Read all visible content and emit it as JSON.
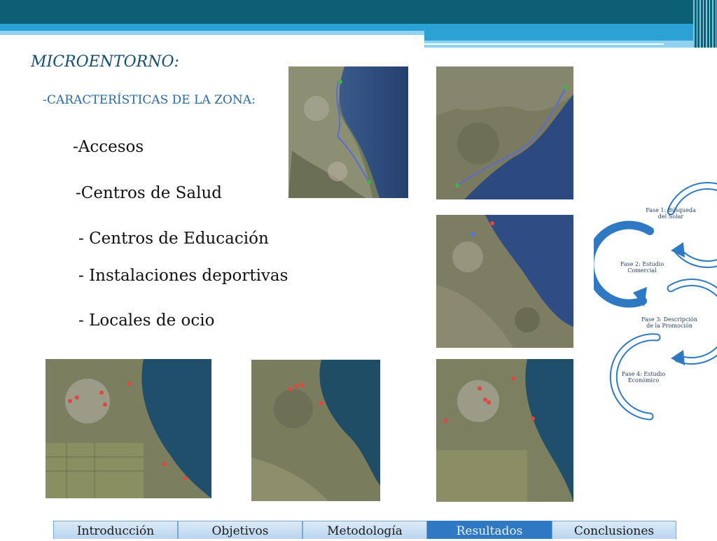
{
  "slide": {
    "title": "MICROENTORNO:",
    "subtitle": "-CARACTERÍSTICAS DE LA ZONA:",
    "items": [
      "-Accesos",
      "-Centros de Salud",
      "- Centros de Educación",
      "- Instalaciones deportivas",
      "- Locales de ocio"
    ]
  },
  "phases": [
    "Fase 1: Búsqueda del Solar",
    "Fase 2: Estudio Comercial",
    "Fase 3: Descripción de la Promoción",
    "Fase 4: Estudio Económico"
  ],
  "nav": {
    "tabs": [
      "Introducción",
      "Objetivos",
      "Metodología",
      "Resultados",
      "Conclusiones"
    ],
    "active": "Resultados"
  },
  "colors": {
    "header_dark": "#0d5f76",
    "header_mid": "#2ca2d4",
    "title": "#134e6e",
    "subtitle": "#2a68a2",
    "arrow_blue": "#2f79c2",
    "tab_active": "#2f79c2"
  },
  "images": [
    "route-map-accesos-1",
    "route-map-accesos-2",
    "satellite-map-salud",
    "satellite-map-educacion",
    "satellite-map-deportivas",
    "satellite-map-ocio"
  ]
}
